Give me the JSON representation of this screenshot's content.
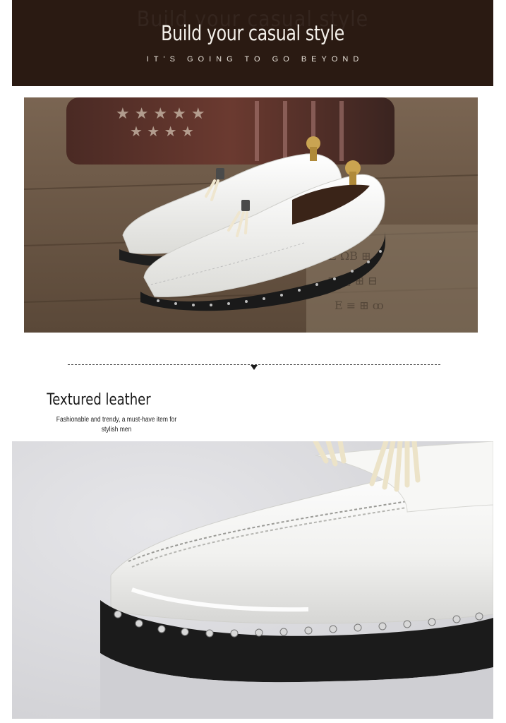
{
  "banner": {
    "title": "Build your casual style",
    "subtitle": "IT'S GOING TO GO BEYOND",
    "bg_color": "#2a1a12"
  },
  "hero_image": {
    "subject": "white patent leather tassel loafers on a wooden floor with a flag-patterned drum behind"
  },
  "section": {
    "title": "Textured leather",
    "description": "Fashionable and trendy, a must-have item for stylish men"
  },
  "detail_image": {
    "subject": "close-up of white patent leather toe with studded black sole and tassels"
  },
  "colors": {
    "accent": "#2a1a12",
    "shoe": "#f6f6f4",
    "sole": "#1c1c1c"
  }
}
